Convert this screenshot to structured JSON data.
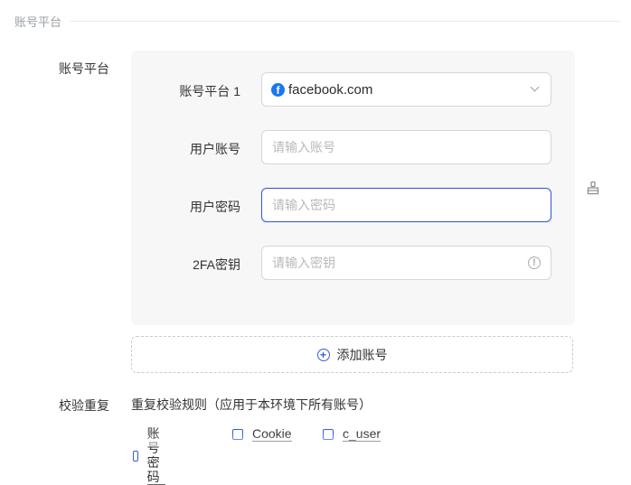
{
  "section": {
    "title": "账号平台"
  },
  "account_platform": {
    "row_label": "账号平台",
    "platform_label": "账号平台 1",
    "platform_value": "facebook.com",
    "username_label": "用户账号",
    "username_placeholder": "请输入账号",
    "password_label": "用户密码",
    "password_placeholder": "请输入密码",
    "twofa_label": "2FA密钥",
    "twofa_placeholder": "请输入密钥",
    "add_account_label": "添加账号"
  },
  "dedup": {
    "row_label": "校验重复",
    "rule_text": "重复校验规则（应用于本环境下所有账号）",
    "options": [
      "账号密码",
      "Cookie",
      "c_user"
    ]
  },
  "colors": {
    "accent": "#3a5bd9",
    "facebook": "#1877f2"
  }
}
